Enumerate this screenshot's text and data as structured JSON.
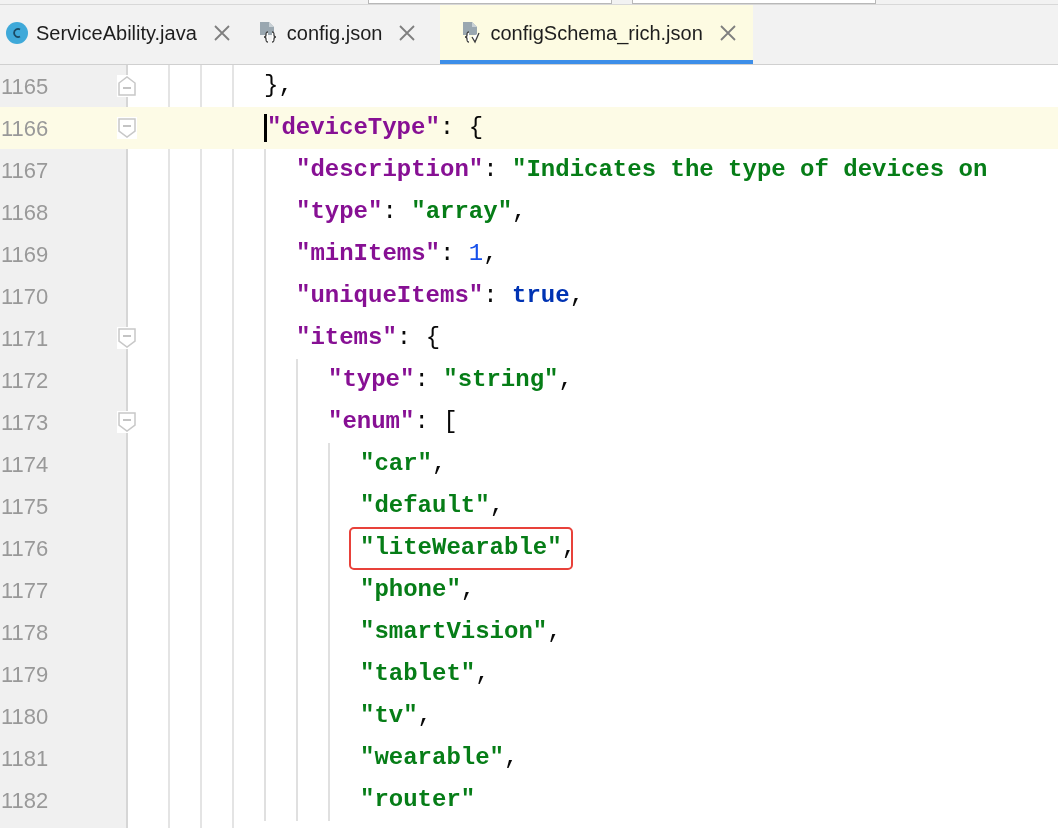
{
  "tabs": [
    {
      "label": "ServiceAbility.java",
      "selected": false
    },
    {
      "label": "config.json",
      "selected": false
    },
    {
      "label": "configSchema_rich.json",
      "selected": true
    }
  ],
  "lines": [
    {
      "number": "1165",
      "kind": "fold_end",
      "current": false,
      "tokens": [
        {
          "kind": "punct",
          "text": "},"
        }
      ]
    },
    {
      "number": "1166",
      "kind": "fold_start",
      "current": true,
      "tokens": [
        {
          "kind": "key",
          "text": "\"deviceType\""
        },
        {
          "kind": "punct",
          "text": ": {"
        }
      ],
      "children": [
        {
          "number": "1167",
          "kind": "plain",
          "current": false,
          "tokens": [
            {
              "kind": "key",
              "text": "\"description\""
            },
            {
              "kind": "punct",
              "text": ": "
            },
            {
              "kind": "string",
              "text": "\"Indicates the type of devices on"
            }
          ]
        },
        {
          "number": "1168",
          "kind": "plain",
          "current": false,
          "tokens": [
            {
              "kind": "key",
              "text": "\"type\""
            },
            {
              "kind": "punct",
              "text": ": "
            },
            {
              "kind": "string",
              "text": "\"array\""
            },
            {
              "kind": "punct",
              "text": ","
            }
          ]
        },
        {
          "number": "1169",
          "kind": "plain",
          "current": false,
          "tokens": [
            {
              "kind": "key",
              "text": "\"minItems\""
            },
            {
              "kind": "punct",
              "text": ": "
            },
            {
              "kind": "number",
              "text": "1"
            },
            {
              "kind": "punct",
              "text": ","
            }
          ]
        },
        {
          "number": "1170",
          "kind": "plain",
          "current": false,
          "tokens": [
            {
              "kind": "key",
              "text": "\"uniqueItems\""
            },
            {
              "kind": "punct",
              "text": ": "
            },
            {
              "kind": "keyword",
              "text": "true"
            },
            {
              "kind": "punct",
              "text": ","
            }
          ]
        },
        {
          "number": "1171",
          "kind": "fold_start",
          "current": false,
          "tokens": [
            {
              "kind": "key",
              "text": "\"items\""
            },
            {
              "kind": "punct",
              "text": ": {"
            }
          ],
          "children": [
            {
              "number": "1172",
              "kind": "plain",
              "current": false,
              "tokens": [
                {
                  "kind": "key",
                  "text": "\"type\""
                },
                {
                  "kind": "punct",
                  "text": ": "
                },
                {
                  "kind": "string",
                  "text": "\"string\""
                },
                {
                  "kind": "punct",
                  "text": ","
                }
              ]
            },
            {
              "number": "1173",
              "kind": "fold_start",
              "current": false,
              "tokens": [
                {
                  "kind": "key",
                  "text": "\"enum\""
                },
                {
                  "kind": "punct",
                  "text": ": ["
                }
              ],
              "children": [
                {
                  "number": "1174",
                  "kind": "plain",
                  "current": false,
                  "tokens": [
                    {
                      "kind": "string",
                      "text": "\"car\""
                    },
                    {
                      "kind": "punct",
                      "text": ","
                    }
                  ]
                },
                {
                  "number": "1175",
                  "kind": "plain",
                  "current": false,
                  "tokens": [
                    {
                      "kind": "string",
                      "text": "\"default\""
                    },
                    {
                      "kind": "punct",
                      "text": ","
                    }
                  ]
                },
                {
                  "number": "1176",
                  "kind": "plain",
                  "current": false,
                  "tokens": [
                    {
                      "kind": "string",
                      "text": "\"liteWearable\"",
                      "boxed": true
                    },
                    {
                      "kind": "punct",
                      "text": ","
                    }
                  ]
                },
                {
                  "number": "1177",
                  "kind": "plain",
                  "current": false,
                  "tokens": [
                    {
                      "kind": "string",
                      "text": "\"phone\""
                    },
                    {
                      "kind": "punct",
                      "text": ","
                    }
                  ]
                },
                {
                  "number": "1178",
                  "kind": "plain",
                  "current": false,
                  "tokens": [
                    {
                      "kind": "string",
                      "text": "\"smartVision\""
                    },
                    {
                      "kind": "punct",
                      "text": ","
                    }
                  ]
                },
                {
                  "number": "1179",
                  "kind": "plain",
                  "current": false,
                  "tokens": [
                    {
                      "kind": "string",
                      "text": "\"tablet\""
                    },
                    {
                      "kind": "punct",
                      "text": ","
                    }
                  ]
                },
                {
                  "number": "1180",
                  "kind": "plain",
                  "current": false,
                  "tokens": [
                    {
                      "kind": "string",
                      "text": "\"tv\""
                    },
                    {
                      "kind": "punct",
                      "text": ","
                    }
                  ]
                },
                {
                  "number": "1181",
                  "kind": "plain",
                  "current": false,
                  "tokens": [
                    {
                      "kind": "string",
                      "text": "\"wearable\""
                    },
                    {
                      "kind": "punct",
                      "text": ","
                    }
                  ]
                },
                {
                  "number": "1182",
                  "kind": "plain",
                  "current": false,
                  "tokens": [
                    {
                      "kind": "string",
                      "text": "\"router\""
                    }
                  ]
                }
              ]
            }
          ]
        }
      ]
    }
  ]
}
